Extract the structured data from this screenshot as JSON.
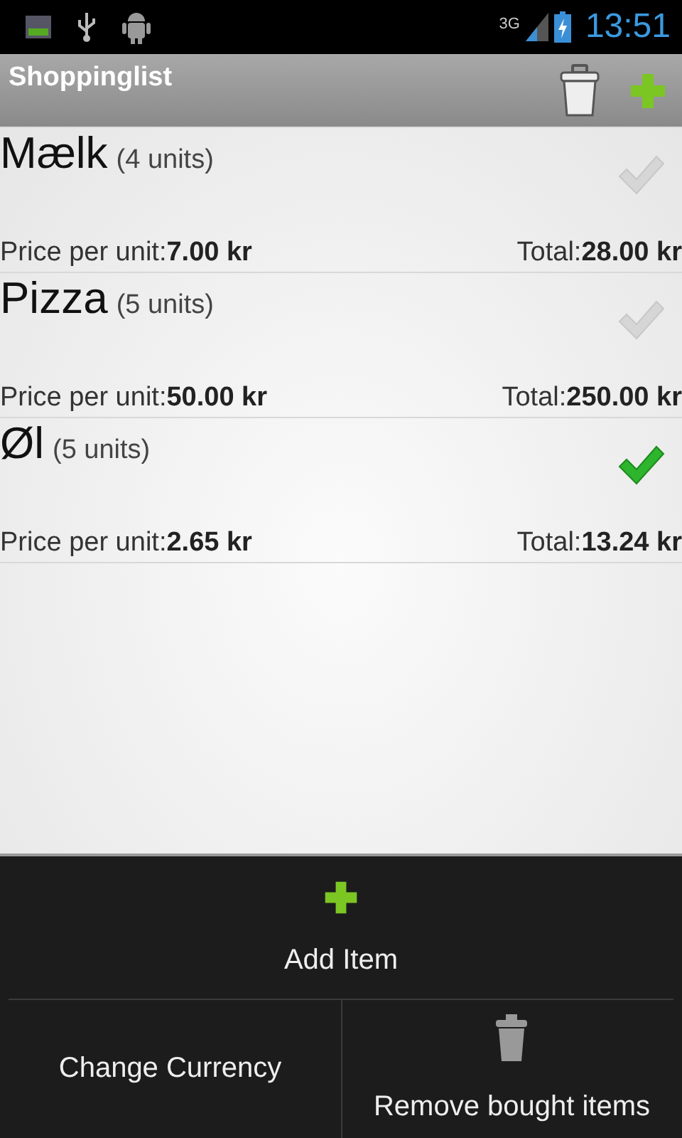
{
  "status_bar": {
    "network": "3G",
    "time": "13:51"
  },
  "action_bar": {
    "title": "Shoppinglist"
  },
  "items": [
    {
      "name": "Mælk",
      "units": "(4 units)",
      "price_label": "Price per unit:",
      "price": "7.00 kr",
      "total_label": "Total:",
      "total": "28.00 kr",
      "bought": false
    },
    {
      "name": "Pizza",
      "units": "(5 units)",
      "price_label": "Price per unit:",
      "price": "50.00 kr",
      "total_label": "Total:",
      "total": "250.00 kr",
      "bought": false
    },
    {
      "name": "Øl",
      "units": "(5 units)",
      "price_label": "Price per unit:",
      "price": "2.65 kr",
      "total_label": "Total:",
      "total": "13.24 kr",
      "bought": true
    }
  ],
  "menu": [
    {
      "label": "Add Item",
      "kind": "add"
    },
    {
      "label": "Change Currency",
      "kind": "plain"
    },
    {
      "label": "Remove bought items",
      "kind": "remove"
    }
  ]
}
